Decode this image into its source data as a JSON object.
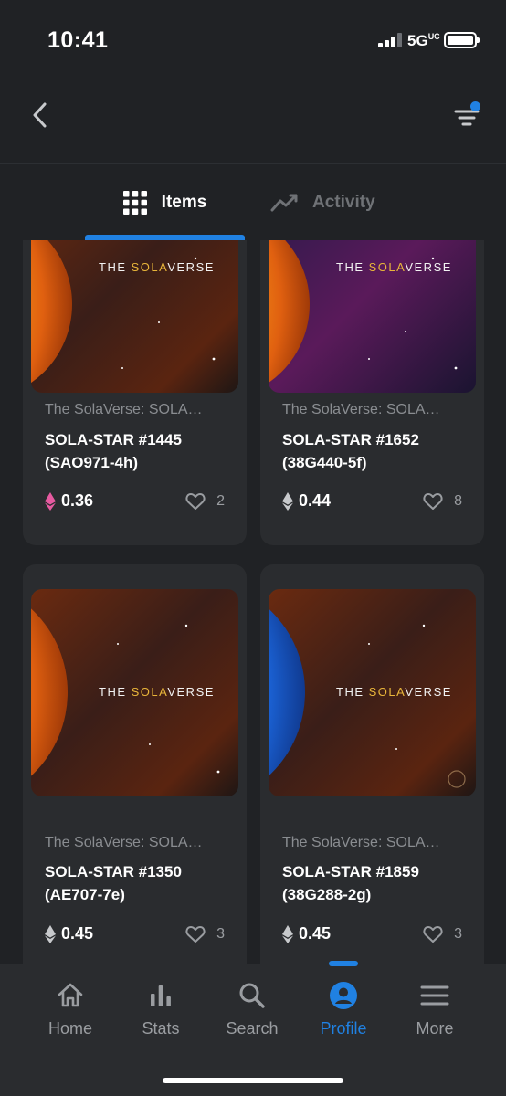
{
  "status_bar": {
    "time": "10:41",
    "network": "5G",
    "network_sub": "UC"
  },
  "tabs": [
    {
      "label": "Items",
      "icon": "grid-icon",
      "active": true
    },
    {
      "label": "Activity",
      "icon": "activity-icon",
      "active": false
    }
  ],
  "items": [
    {
      "collection": "The SolaVerse: SOLA…",
      "name": "SOLA-STAR #1445 (SAO971-4h)",
      "price": "0.36",
      "currency_icon": "polygon-eth-icon",
      "currency_color": "#e65aa0",
      "likes": "2",
      "art_text_pre": "THE ",
      "art_text_mid": "SOLA",
      "art_text_post": "VERSE"
    },
    {
      "collection": "The SolaVerse: SOLA…",
      "name": "SOLA-STAR #1652 (38G440-5f)",
      "price": "0.44",
      "currency_icon": "eth-icon",
      "currency_color": "#c7c9cc",
      "likes": "8",
      "art_text_pre": "THE ",
      "art_text_mid": "SOLA",
      "art_text_post": "VERSE"
    },
    {
      "collection": "The SolaVerse: SOLA…",
      "name": "SOLA-STAR #1350 (AE707-7e)",
      "price": "0.45",
      "currency_icon": "eth-icon",
      "currency_color": "#c7c9cc",
      "likes": "3",
      "art_text_pre": "THE ",
      "art_text_mid": "SOLA",
      "art_text_post": "VERSE"
    },
    {
      "collection": "The SolaVerse: SOLA…",
      "name": "SOLA-STAR #1859 (38G288-2g)",
      "price": "0.45",
      "currency_icon": "eth-icon",
      "currency_color": "#c7c9cc",
      "likes": "3",
      "art_text_pre": "THE ",
      "art_text_mid": "SOLA",
      "art_text_post": "VERSE"
    }
  ],
  "bottom_nav": [
    {
      "label": "Home",
      "icon": "home-icon"
    },
    {
      "label": "Stats",
      "icon": "stats-icon"
    },
    {
      "label": "Search",
      "icon": "search-icon"
    },
    {
      "label": "Profile",
      "icon": "profile-icon",
      "active": true
    },
    {
      "label": "More",
      "icon": "menu-icon"
    }
  ],
  "colors": {
    "accent": "#2081e2",
    "background": "#202225",
    "card": "#2a2c2f",
    "gold": "#e8b53a"
  }
}
